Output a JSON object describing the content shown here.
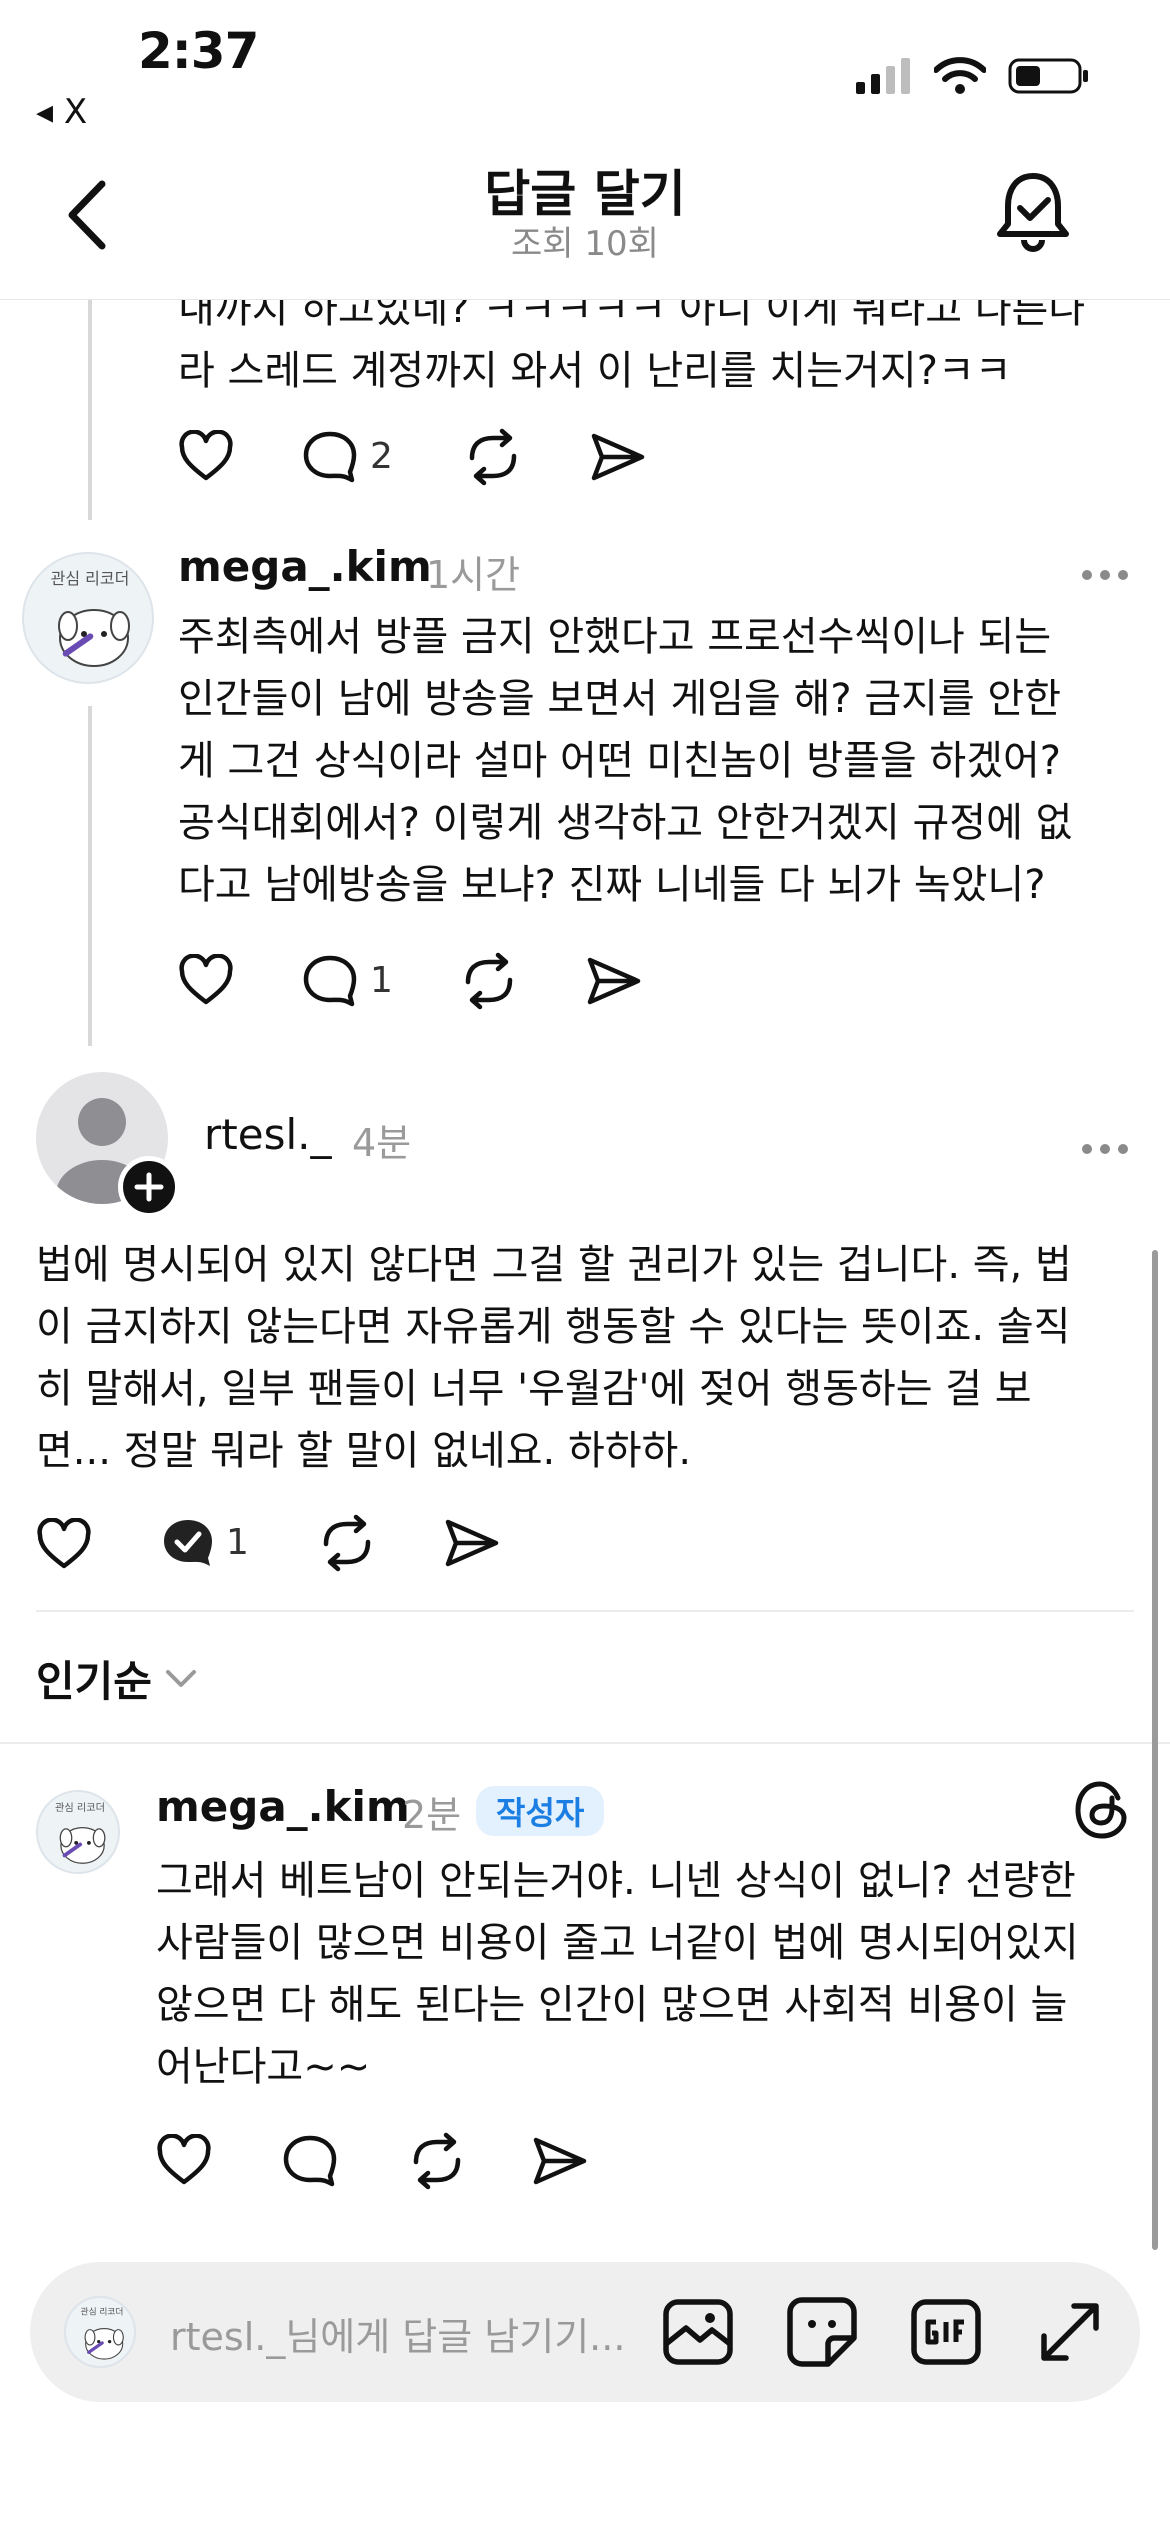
{
  "status_bar": {
    "time": "2:37",
    "back_app": "◂ X"
  },
  "header": {
    "title": "답글 달기",
    "subtitle": "조회 10회"
  },
  "posts": [
    {
      "lines": [
        "내까지 하고있네? ㅋㅋㅋㅋㅋ 아니 이게 뭐라고 다른나",
        "라 스레드 계정까지 와서 이 난리를 치는거지?ㅋㅋ"
      ],
      "reply_count": "2"
    },
    {
      "username": "mega_.kim",
      "time": "1시간",
      "avatar_text": "관심 리코더",
      "lines": [
        "주최측에서 방플 금지 안했다고 프로선수씩이나 되는",
        "인간들이 남에 방송을 보면서 게임을 해? 금지를 안한",
        "게 그건 상식이라 설마 어떤 미친놈이 방플을 하겠어?",
        "공식대회에서? 이렇게 생각하고 안한거겠지 규정에 없",
        "다고 남에방송을 보냐? 진짜 니네들 다 뇌가 녹았니?"
      ],
      "reply_count": "1"
    },
    {
      "username": "rtesl._",
      "time": "4분",
      "lines": [
        "법에 명시되어 있지 않다면 그걸 할 권리가 있는 겁니다. 즉, 법",
        "이 금지하지 않는다면 자유롭게 행동할 수 있다는 뜻이죠. 솔직",
        "히 말해서, 일부 팬들이 너무 '우월감'에 젖어 행동하는 걸 보",
        "면... 정말 뭐라 할 말이 없네요. 하하하."
      ],
      "reply_count": "1"
    }
  ],
  "sort": {
    "label": "인기순"
  },
  "reply": {
    "username": "mega_.kim",
    "time": "2분",
    "badge": "작성자",
    "avatar_text": "관심 리코더",
    "lines": [
      "그래서 베트남이 안되는거야. 니넨 상식이 없니? 선량한",
      "사람들이 많으면 비용이 줄고 너같이 법에 명시되어있지",
      "않으면 다 해도 된다는 인간이 많으면 사회적 비용이 늘",
      "어난다고~~"
    ]
  },
  "composer": {
    "placeholder": "rtesl._님에게 답글 남기기...",
    "avatar_text": "관심 리코더"
  },
  "icons": {
    "like": "heart-icon",
    "reply": "speech-bubble-icon",
    "repost": "repost-icon",
    "share": "send-icon",
    "more": "more-dots-icon",
    "threads": "threads-logo-icon"
  }
}
